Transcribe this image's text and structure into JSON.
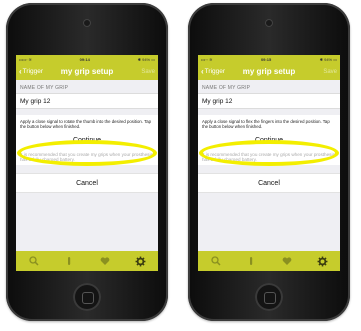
{
  "colors": {
    "accent": "#c6cc2c",
    "highlight": "#f3ee00",
    "device": "#1a1a1a"
  },
  "screens": [
    {
      "status": {
        "carrier": "•••••◦ ≋",
        "time": "09:14",
        "battery": "✱ 94% ▭"
      },
      "nav": {
        "back_label": "Trigger",
        "title": "my grip setup",
        "save_label": "Save"
      },
      "section_header": "NAME OF MY GRIP",
      "name_value": "My grip 12",
      "instruction": "Apply a close signal to rotate the thumb into the desired position. Tap the button below when finished.",
      "continue_label": "Continue",
      "recommend": "It is recommended that you create my grips when your prosthesis has a fully charged battery.",
      "cancel_label": "Cancel",
      "tab_icons": [
        "search-icon",
        "finger-icon",
        "heart-icon",
        "gear-icon"
      ]
    },
    {
      "status": {
        "carrier": "•••◦◦ ≋",
        "time": "09:15",
        "battery": "✱ 94% ▭"
      },
      "nav": {
        "back_label": "Trigger",
        "title": "my grip setup",
        "save_label": "Save"
      },
      "section_header": "NAME OF MY GRIP",
      "name_value": "My grip 12",
      "instruction": "Apply a close signal to flex the fingers into the desired position. Tap the button below when finished.",
      "continue_label": "Continue",
      "recommend": "It is recommended that you create my grips when your prosthesis has a fully charged battery.",
      "cancel_label": "Cancel",
      "tab_icons": [
        "search-icon",
        "finger-icon",
        "heart-icon",
        "gear-icon"
      ]
    }
  ]
}
